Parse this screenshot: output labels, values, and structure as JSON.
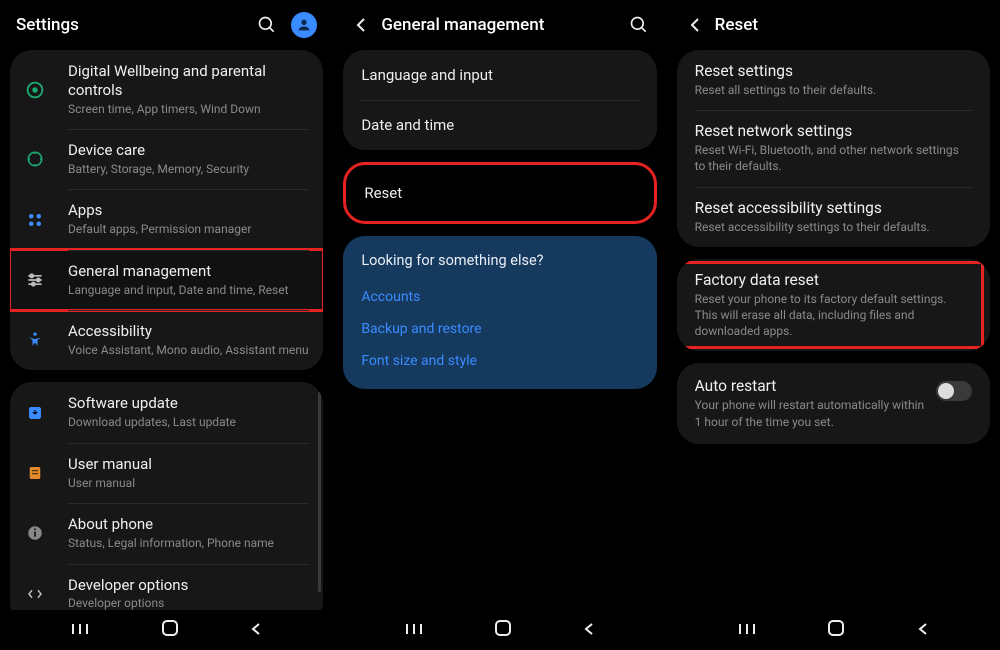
{
  "screen1": {
    "title": "Settings",
    "group1": [
      {
        "icon": "wellbeing",
        "title": "Digital Wellbeing and parental controls",
        "sub": "Screen time, App timers, Wind Down"
      },
      {
        "icon": "devicecare",
        "title": "Device care",
        "sub": "Battery, Storage, Memory, Security"
      },
      {
        "icon": "apps",
        "title": "Apps",
        "sub": "Default apps, Permission manager"
      },
      {
        "icon": "general",
        "title": "General management",
        "sub": "Language and input, Date and time, Reset"
      },
      {
        "icon": "accessibility",
        "title": "Accessibility",
        "sub": "Voice Assistant, Mono audio, Assistant menu"
      }
    ],
    "group2": [
      {
        "icon": "update",
        "title": "Software update",
        "sub": "Download updates, Last update"
      },
      {
        "icon": "manual",
        "title": "User manual",
        "sub": "User manual"
      },
      {
        "icon": "about",
        "title": "About phone",
        "sub": "Status, Legal information, Phone name"
      },
      {
        "icon": "dev",
        "title": "Developer options",
        "sub": "Developer options"
      }
    ]
  },
  "screen2": {
    "title": "General management",
    "rows": [
      {
        "label": "Language and input"
      },
      {
        "label": "Date and time"
      }
    ],
    "rows2": [
      {
        "label": "Reset"
      }
    ],
    "looking": {
      "title": "Looking for something else?",
      "links": [
        "Accounts",
        "Backup and restore",
        "Font size and style"
      ]
    }
  },
  "screen3": {
    "title": "Reset",
    "resets": [
      {
        "title": "Reset settings",
        "sub": "Reset all settings to their defaults."
      },
      {
        "title": "Reset network settings",
        "sub": "Reset Wi-Fi, Bluetooth, and other network settings to their defaults."
      },
      {
        "title": "Reset accessibility settings",
        "sub": "Reset accessibility settings to their defaults."
      }
    ],
    "factory": {
      "title": "Factory data reset",
      "sub": "Reset your phone to its factory default settings. This will erase all data, including files and downloaded apps."
    },
    "auto": {
      "title": "Auto restart",
      "sub": "Your phone will restart automatically within 1 hour of the time you set."
    }
  }
}
